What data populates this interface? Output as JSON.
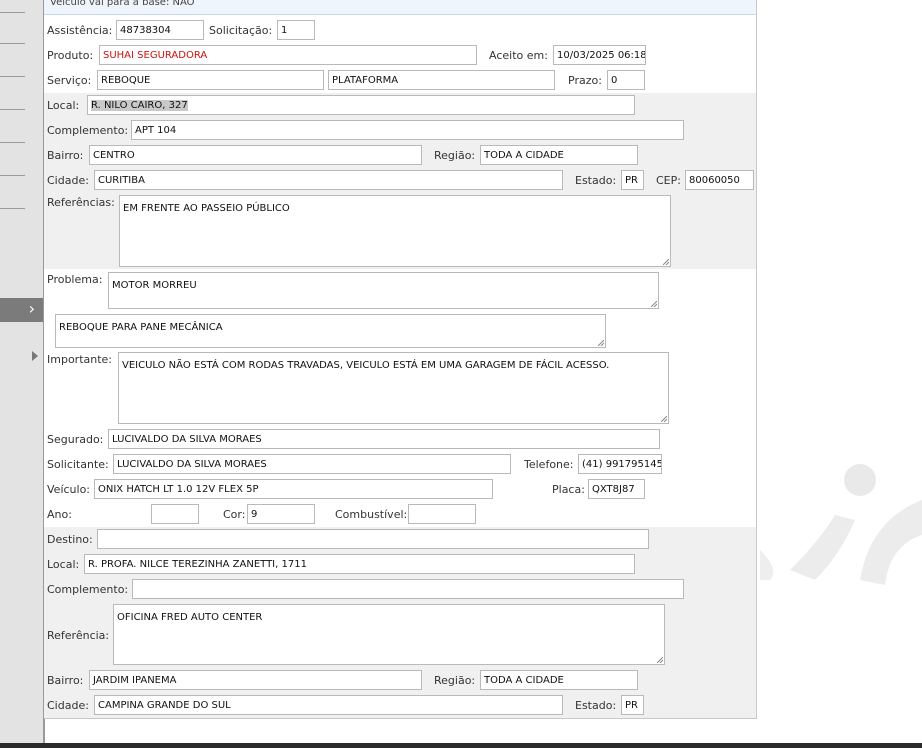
{
  "top_note": "Veículo vai para a base: NÃO",
  "sidebar": {
    "expand_icon": "chevron-right-icon",
    "tree_icon": "triangle-right-icon"
  },
  "form": {
    "assistencia": {
      "label": "Assistência:",
      "value": "48738304"
    },
    "solicitacao": {
      "label": "Solicitação:",
      "value": "1"
    },
    "produto": {
      "label": "Produto:",
      "value": "SUHAI SEGURADORA"
    },
    "aceito_em": {
      "label": "Aceito em:",
      "value": "10/03/2025 06:18"
    },
    "servico": {
      "label": "Serviço:",
      "value": "REBOQUE",
      "value2": "PLATAFORMA"
    },
    "prazo": {
      "label": "Prazo:",
      "value": "0"
    },
    "local": {
      "label": "Local:",
      "value": "R. NILO CAIRO, 327"
    },
    "complemento": {
      "label": "Complemento:",
      "value": "APT 104"
    },
    "bairro": {
      "label": "Bairro:",
      "value": "CENTRO"
    },
    "regiao": {
      "label": "Região:",
      "value": "TODA A CIDADE"
    },
    "cidade": {
      "label": "Cidade:",
      "value": "CURITIBA"
    },
    "estado": {
      "label": "Estado:",
      "value": "PR"
    },
    "cep": {
      "label": "CEP:",
      "value": "80060050"
    },
    "referencias": {
      "label": "Referências:",
      "value": "EM FRENTE AO PASSEIO PÚBLICO"
    },
    "problema": {
      "label": "Problema:",
      "value": "MOTOR MORREU"
    },
    "descricao": {
      "value": "REBOQUE PARA PANE MECÂNICA"
    },
    "importante": {
      "label": "Importante:",
      "value": "VEICULO NÃO ESTÁ COM RODAS TRAVADAS,  VEICULO ESTÁ EM UMA GARAGEM DE FÁCIL ACESSO."
    },
    "segurado": {
      "label": "Segurado:",
      "value": "LUCIVALDO DA SILVA MORAES"
    },
    "solicitante": {
      "label": "Solicitante:",
      "value": "LUCIVALDO DA SILVA MORAES"
    },
    "telefone": {
      "label": "Telefone:",
      "value": "(41) 991795145"
    },
    "veiculo": {
      "label": "Veículo:",
      "value": "ONIX HATCH LT 1.0 12V FLEX 5P"
    },
    "placa": {
      "label": "Placa:",
      "value": "QXT8J87"
    },
    "ano": {
      "label": "Ano:",
      "value": ""
    },
    "cor": {
      "label": "Cor:",
      "value": "9"
    },
    "combustivel": {
      "label": "Combustível:",
      "value": ""
    }
  },
  "destino_section": {
    "destino": {
      "label": "Destino:",
      "value": ""
    },
    "local": {
      "label": "Local:",
      "value": "R. PROFA. NILCE TEREZINHA ZANETTI, 1711"
    },
    "complemento": {
      "label": "Complemento:",
      "value": ""
    },
    "referencia": {
      "label": "Referência:",
      "value": "OFICINA FRED AUTO CENTER"
    },
    "bairro": {
      "label": "Bairro:",
      "value": "JARDIM IPANEMA"
    },
    "regiao": {
      "label": "Região:",
      "value": "TODA A CIDADE"
    },
    "cidade": {
      "label": "Cidade:",
      "value": "CAMPINA GRANDE DO SUL"
    },
    "estado": {
      "label": "Estado:",
      "value": "PR"
    }
  },
  "colors": {
    "red_text": "#cc1111",
    "band": "#f0f0f0",
    "sidebar": "#e3e3e3"
  }
}
